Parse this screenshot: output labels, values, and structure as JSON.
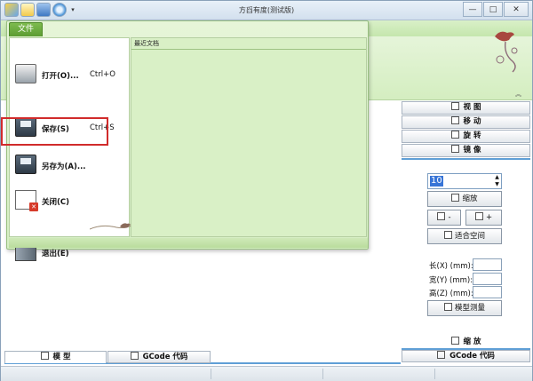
{
  "window": {
    "title": "方舀有度(测试版)",
    "controls": {
      "minimize": "—",
      "maximize": "□",
      "close": "✕"
    },
    "qat_dropdown": "▾"
  },
  "file_menu": {
    "tab_label": "文件",
    "recent_header": "最近文档",
    "items": [
      {
        "label": "打开(O)...",
        "shortcut": "Ctrl+O",
        "icon": "folder-open-icon"
      },
      {
        "label": "保存(S)",
        "shortcut": "Ctrl+S",
        "icon": "save-icon"
      },
      {
        "label": "另存为(A)...",
        "shortcut": "",
        "icon": "save-as-icon"
      },
      {
        "label": "关闭(C)",
        "shortcut": "",
        "icon": "close-document-icon"
      },
      {
        "label": "退出(E)",
        "shortcut": "",
        "icon": "exit-icon"
      }
    ]
  },
  "ribbon": {
    "collapse_glyph": "︽"
  },
  "right_panel": {
    "tabs": [
      "视 图",
      "移 动",
      "旋 转",
      "镜 像"
    ],
    "scale_value": "10",
    "spin_up": "▲",
    "spin_down": "▼",
    "scale_button": "缩放",
    "minus_button": "-",
    "plus_button": "+",
    "fit_button": "适合空间",
    "dimensions": [
      {
        "label": "长(X) (mm):",
        "value": ""
      },
      {
        "label": "宽(Y) (mm):",
        "value": ""
      },
      {
        "label": "高(Z) (mm):",
        "value": ""
      }
    ],
    "measure_button": "模型测量",
    "bottom_tabs": [
      "缩 放",
      "GCode 代码"
    ]
  },
  "bottom_tabs": [
    "模 型",
    "GCode 代码"
  ],
  "colors": {
    "accent_blue": "#5f9fd6",
    "menu_green": "#d9f0c6",
    "file_tab_green": "#6aa93f",
    "highlight_red": "#d12b2b"
  }
}
